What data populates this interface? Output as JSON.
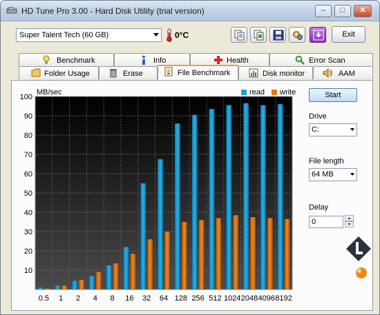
{
  "window": {
    "title": "HD Tune Pro 3.00 - Hard Disk Utility (trial version)",
    "buttons": {
      "minimize": "–",
      "maximize": "□",
      "close": "✕"
    }
  },
  "toolbar": {
    "drive": "Super Talent Tech (60 GB)",
    "temperature": "0°C",
    "exit_label": "Exit",
    "icons": [
      "copy-text-icon",
      "copy-screenshot-icon",
      "save-icon",
      "options-icon",
      "download-icon"
    ]
  },
  "tabs": {
    "row1": [
      "Benchmark",
      "Info",
      "Health",
      "Error Scan"
    ],
    "row2": [
      "Folder Usage",
      "Erase",
      "File Benchmark",
      "Disk monitor",
      "AAM"
    ],
    "active": "File Benchmark"
  },
  "side": {
    "start_label": "Start",
    "drive_label": "Drive",
    "drive_value": "C:",
    "file_length_label": "File length",
    "file_length_value": "64 MB",
    "delay_label": "Delay",
    "delay_value": "0"
  },
  "chart_data": {
    "type": "bar",
    "ylabel": "MB/sec",
    "ylim": [
      0,
      100
    ],
    "yticks": [
      10,
      20,
      30,
      40,
      50,
      60,
      70,
      80,
      90,
      100
    ],
    "categories": [
      "0.5",
      "1",
      "2",
      "4",
      "8",
      "16",
      "32",
      "64",
      "128",
      "256",
      "512",
      "1024",
      "2048",
      "4096",
      "8192"
    ],
    "series": [
      {
        "name": "read",
        "color": "#1b9fd8",
        "values": [
          1,
          2,
          4.5,
          7,
          12.5,
          22,
          55,
          67.5,
          86,
          90.5,
          93.5,
          95.5,
          96.5,
          95.5,
          96
        ]
      },
      {
        "name": "write",
        "color": "#e2761a",
        "values": [
          0.5,
          2,
          5,
          9,
          13.5,
          18.5,
          26,
          30,
          35,
          36,
          37,
          38.5,
          37.5,
          37,
          36.5
        ]
      }
    ],
    "grid": true,
    "legend": "top-right"
  }
}
